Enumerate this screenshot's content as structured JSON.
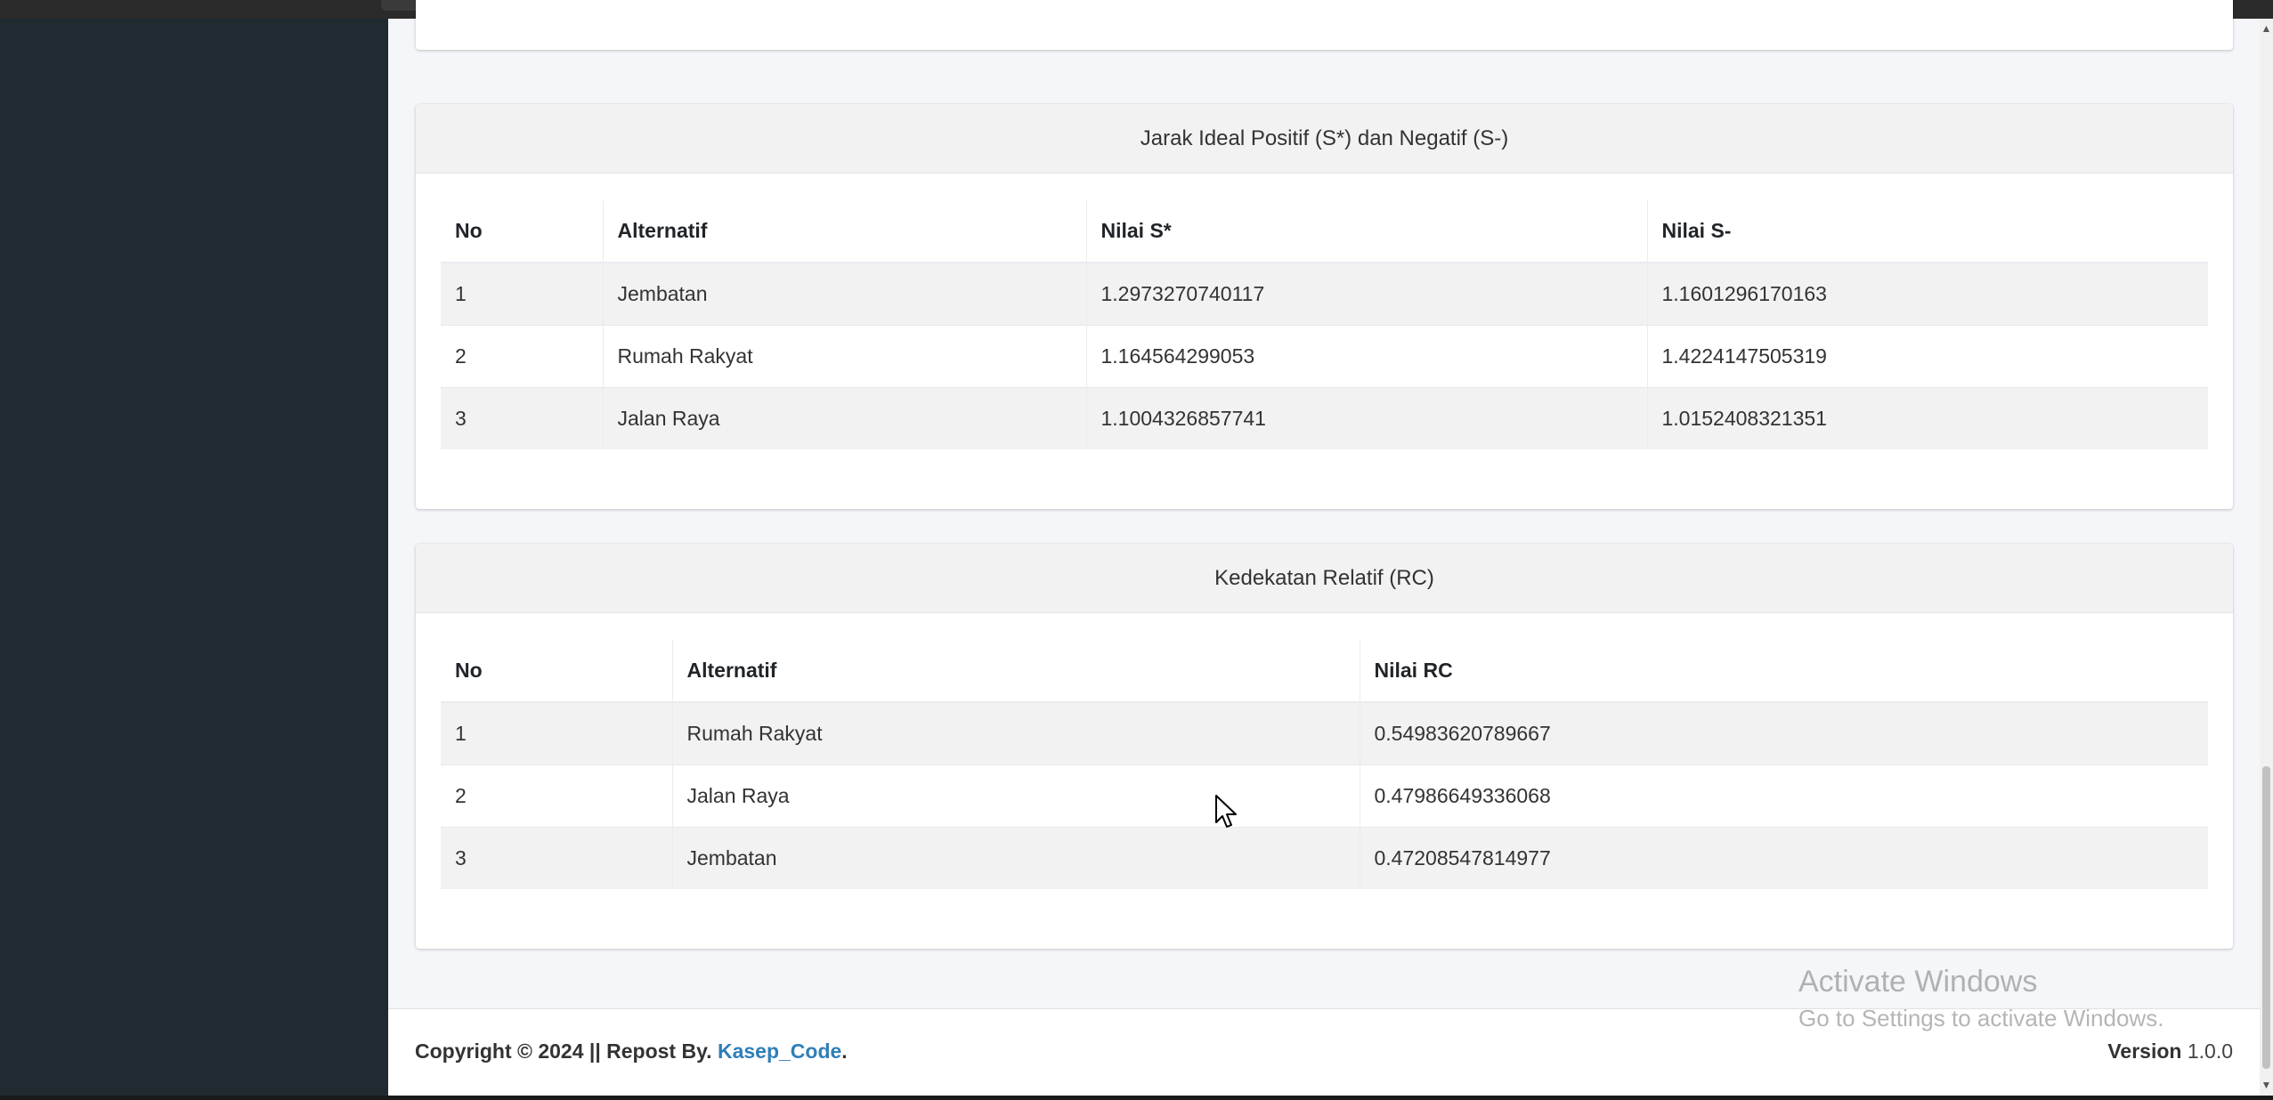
{
  "card1": {
    "title": "Jarak Ideal Positif (S*) dan Negatif (S-)",
    "headers": [
      "No",
      "Alternatif",
      "Nilai S*",
      "Nilai S-"
    ],
    "rows": [
      [
        "1",
        "Jembatan",
        "1.2973270740117",
        "1.1601296170163"
      ],
      [
        "2",
        "Rumah Rakyat",
        "1.164564299053",
        "1.4224147505319"
      ],
      [
        "3",
        "Jalan Raya",
        "1.1004326857741",
        "1.0152408321351"
      ]
    ]
  },
  "card2": {
    "title": "Kedekatan Relatif (RC)",
    "headers": [
      "No",
      "Alternatif",
      "Nilai RC"
    ],
    "rows": [
      [
        "1",
        "Rumah Rakyat",
        "0.54983620789667"
      ],
      [
        "2",
        "Jalan Raya",
        "0.47986649336068"
      ],
      [
        "3",
        "Jembatan",
        "0.47208547814977"
      ]
    ]
  },
  "footer": {
    "copyright": "Copyright © 2024 || Repost By. ",
    "link": "Kasep_Code",
    "dot": ".",
    "version_label": "Version",
    "version_value": "1.0.0"
  },
  "watermark": {
    "line1": "Activate Windows",
    "line2": "Go to Settings to activate Windows."
  },
  "colors": {
    "link": "#2e7fb8",
    "sidebar": "#202b31",
    "content_bg": "#f4f6f9"
  }
}
